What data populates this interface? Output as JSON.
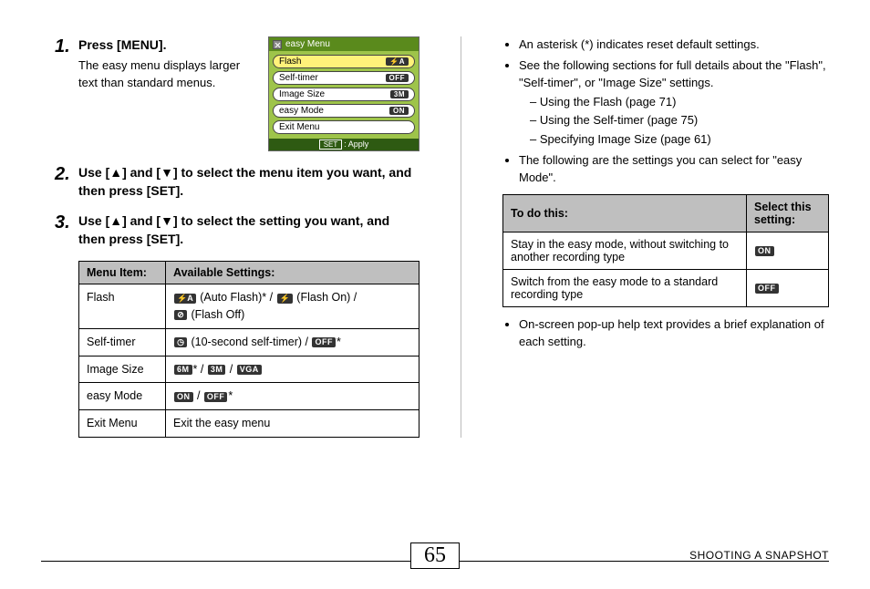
{
  "steps": {
    "s1": {
      "num": "1.",
      "title": "Press [MENU].",
      "desc": "The easy menu displays larger text than standard menus."
    },
    "s2": {
      "num": "2.",
      "title": "Use [▲] and [▼] to select the menu item you want, and then press [SET]."
    },
    "s3": {
      "num": "3.",
      "title": "Use [▲] and [▼] to select the setting you want, and then press [SET]."
    }
  },
  "easyMenu": {
    "title": "easy Menu",
    "rows": [
      {
        "label": "Flash",
        "badge": "⚡A"
      },
      {
        "label": "Self-timer",
        "badge": "OFF"
      },
      {
        "label": "Image Size",
        "badge": "3M"
      },
      {
        "label": "easy Mode",
        "badge": "ON"
      },
      {
        "label": "Exit Menu",
        "badge": ""
      }
    ],
    "foot_set": "SET",
    "foot_apply": ": Apply"
  },
  "settingsTable": {
    "h1": "Menu Item:",
    "h2": "Available Settings:",
    "r1c1": "Flash",
    "r1_autoFlash": "(Auto Flash)",
    "r1_flashOn": "(Flash On) /",
    "r1_flashOff": "(Flash Off)",
    "r2c1": "Self-timer",
    "r2_timer": "(10-second self-timer) /",
    "r3c1": "Image Size",
    "r4c1": "easy Mode",
    "r5c1": "Exit Menu",
    "r5c2": "Exit the easy menu"
  },
  "icons": {
    "flashAuto": "⚡A",
    "flashOn": "⚡",
    "flashOff": "⊘",
    "timer": "◷",
    "off": "OFF",
    "on": "ON",
    "m6": "6M",
    "m3": "3M",
    "vga": "VGA"
  },
  "right": {
    "b1": "An asterisk (*) indicates reset default settings.",
    "b2": "See the following sections for full details about the \"Flash\", \"Self-timer\", or \"Image Size\" settings.",
    "d1": "Using the Flash (page 71)",
    "d2": "Using the Self-timer (page 75)",
    "d3": "Specifying Image Size (page 61)",
    "b3": "The following are the settings you can select for \"easy Mode\".",
    "th1": "To do this:",
    "th2": "Select this setting:",
    "r1": "Stay in the easy mode, without switching to another recording type",
    "r2": "Switch from the easy mode to a standard recording type",
    "b4": "On-screen pop-up help text provides a brief explanation of each setting."
  },
  "footer": {
    "page": "65",
    "section": "SHOOTING A SNAPSHOT"
  }
}
